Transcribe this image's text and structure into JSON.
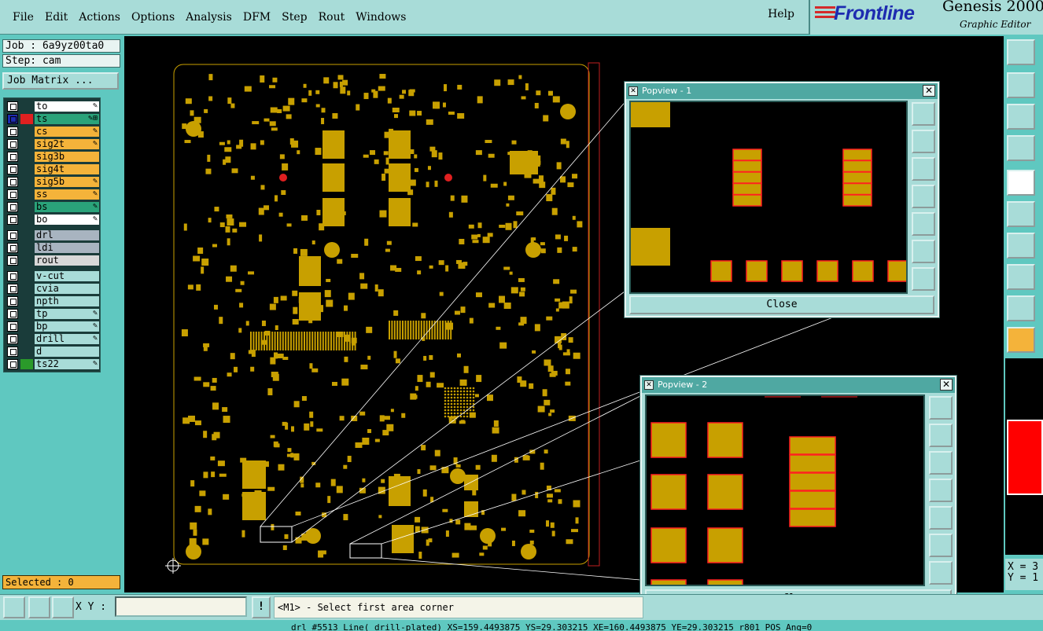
{
  "menu": {
    "items": [
      "File",
      "Edit",
      "Actions",
      "Options",
      "Analysis",
      "DFM",
      "Step",
      "Rout",
      "Windows"
    ],
    "help": "Help"
  },
  "logo": {
    "brand": "Frontline",
    "product": "Genesis 2000",
    "subtitle": "Graphic Editor"
  },
  "job": {
    "job_line": "Job : 6a9yz00ta0",
    "step_line": "Step: cam",
    "matrix_button": "Job Matrix ..."
  },
  "layers": {
    "group1": [
      {
        "name": "to",
        "bg": "#ffffff",
        "swatch": "",
        "flag": "✎"
      },
      {
        "name": "ts",
        "bg": "#2aa37a",
        "swatch": "#e02020",
        "flag": "✎⊞",
        "active": true
      },
      {
        "name": "cs",
        "bg": "#f4b33a",
        "swatch": "",
        "flag": "✎"
      },
      {
        "name": "sig2t",
        "bg": "#f4b33a",
        "swatch": "",
        "flag": "✎"
      },
      {
        "name": "sig3b",
        "bg": "#f4b33a",
        "swatch": "",
        "flag": ""
      },
      {
        "name": "sig4t",
        "bg": "#f4b33a",
        "swatch": "",
        "flag": ""
      },
      {
        "name": "sig5b",
        "bg": "#f4b33a",
        "swatch": "",
        "flag": "✎"
      },
      {
        "name": "ss",
        "bg": "#f4b33a",
        "swatch": "",
        "flag": "✎"
      },
      {
        "name": "bs",
        "bg": "#2aa37a",
        "swatch": "",
        "flag": "✎"
      },
      {
        "name": "bo",
        "bg": "#ffffff",
        "swatch": "",
        "flag": "✎"
      }
    ],
    "group2": [
      {
        "name": "drl",
        "bg": "#a8b4c0",
        "swatch": "",
        "flag": ""
      },
      {
        "name": "ldi",
        "bg": "#a8b4c0",
        "swatch": "",
        "flag": ""
      },
      {
        "name": "rout",
        "bg": "#d8d8d8",
        "swatch": "",
        "flag": ""
      }
    ],
    "group3": [
      {
        "name": "v-cut",
        "bg": "#a8dcd8",
        "swatch": "",
        "flag": ""
      },
      {
        "name": "cvia",
        "bg": "#a8dcd8",
        "swatch": "",
        "flag": ""
      },
      {
        "name": "npth",
        "bg": "#a8dcd8",
        "swatch": "",
        "flag": ""
      },
      {
        "name": "tp",
        "bg": "#a8dcd8",
        "swatch": "",
        "flag": "✎"
      },
      {
        "name": "bp",
        "bg": "#a8dcd8",
        "swatch": "",
        "flag": "✎"
      },
      {
        "name": "drill",
        "bg": "#a8dcd8",
        "swatch": "",
        "flag": "✎"
      },
      {
        "name": "d",
        "bg": "#a8dcd8",
        "swatch": "",
        "flag": ""
      },
      {
        "name": "ts22",
        "bg": "#a8dcd8",
        "swatch": "#2a9a2a",
        "flag": "✎"
      }
    ]
  },
  "selected": "Selected : 0",
  "popview1": {
    "title": "Popview - 1",
    "close_label": "Close"
  },
  "popview2": {
    "title": "Popview - 2",
    "close_label": "Close"
  },
  "bottom": {
    "xy_label": "X Y :",
    "xy_value": "",
    "bang": "!",
    "prompt": "<M1> - Select first area corner",
    "status": "drl #5513 Line( drill-plated) XS=159.4493875 YS=29.303215 XE=160.4493875 YE=29.303215 r801 POS Ang=0"
  },
  "coords": {
    "x": "X = 3",
    "y": "Y = 1"
  },
  "colors": {
    "pad": "#c8a000",
    "outline": "#ff2020",
    "panel": "#5fc8c0"
  }
}
